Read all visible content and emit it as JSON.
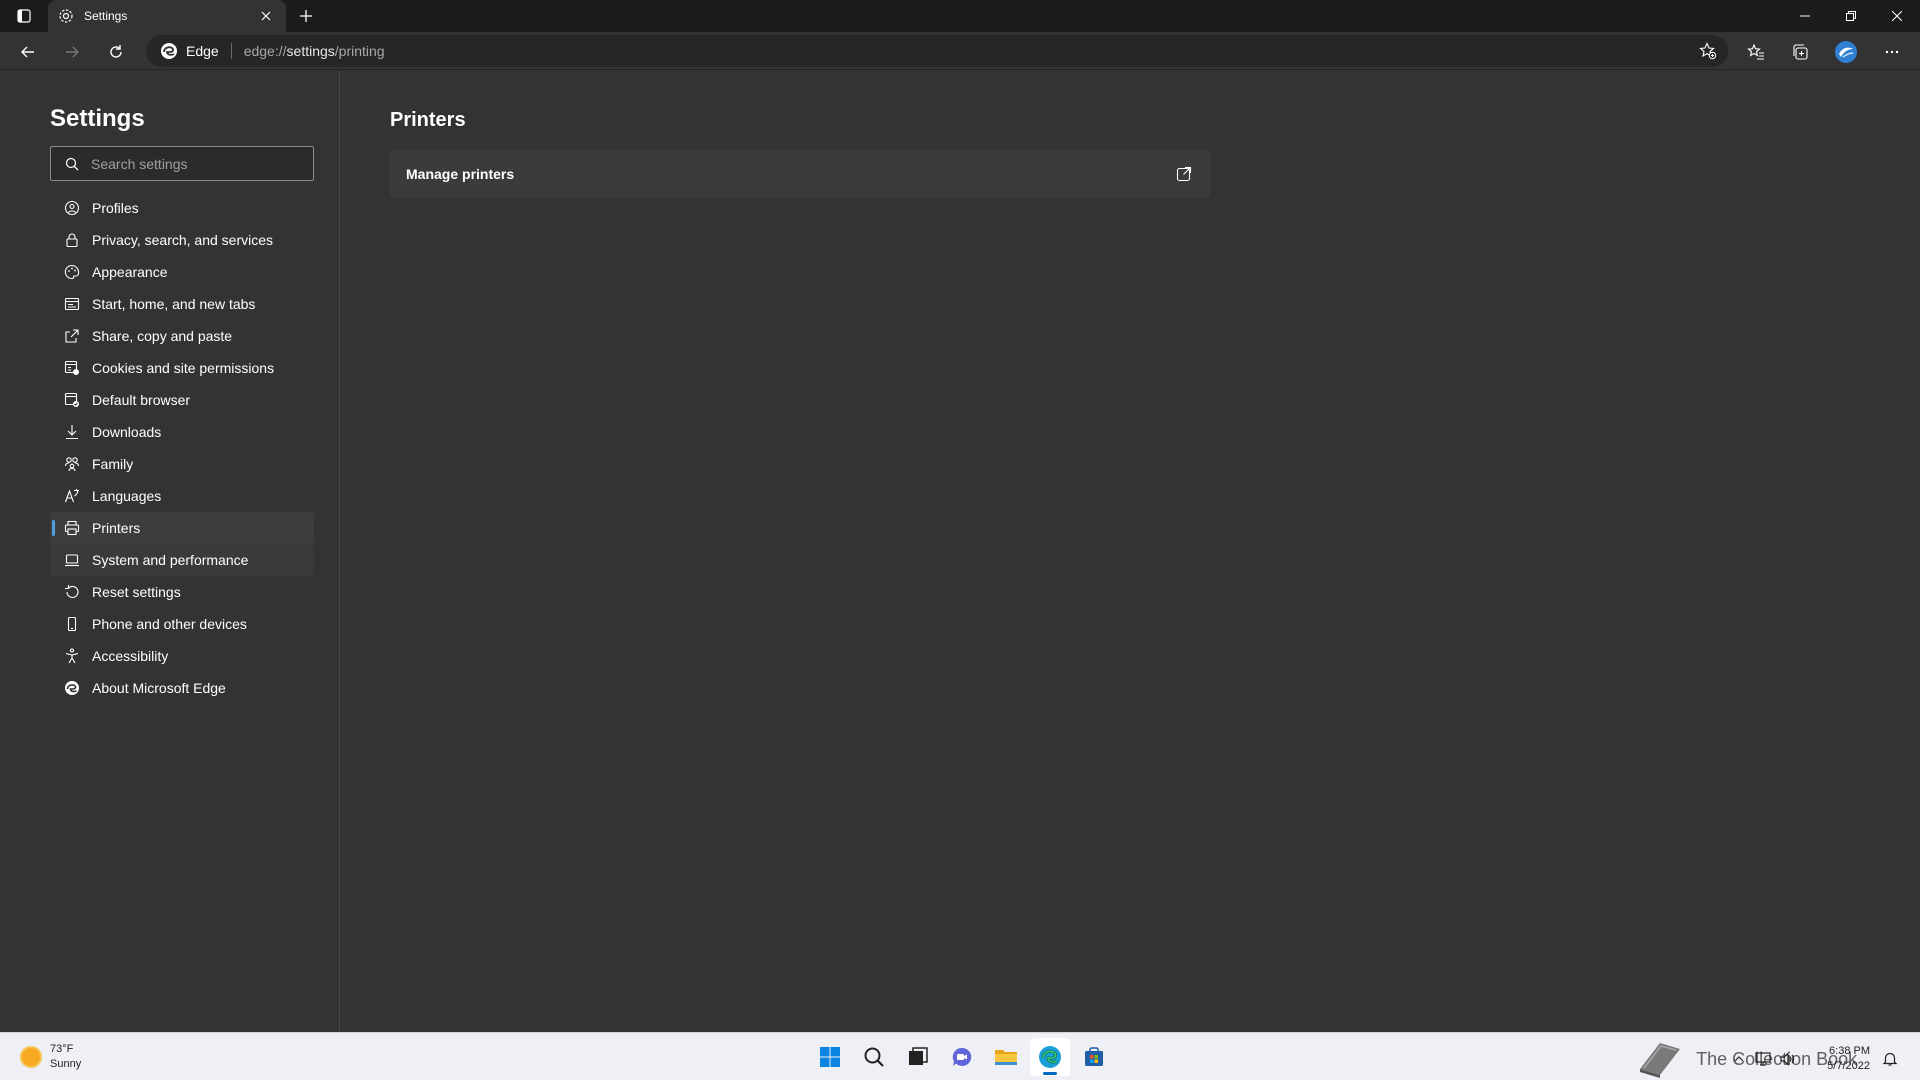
{
  "browser": {
    "tab": {
      "title": "Settings",
      "icon": "gear-icon"
    },
    "address": {
      "identity_label": "Edge",
      "url_prefix": "edge://",
      "url_host": "settings",
      "url_path": "/printing"
    }
  },
  "sidebar": {
    "title": "Settings",
    "search_placeholder": "Search settings",
    "items": [
      {
        "label": "Profiles",
        "icon": "profile-icon"
      },
      {
        "label": "Privacy, search, and services",
        "icon": "lock-icon"
      },
      {
        "label": "Appearance",
        "icon": "palette-icon"
      },
      {
        "label": "Start, home, and new tabs",
        "icon": "home-tab-icon"
      },
      {
        "label": "Share, copy and paste",
        "icon": "share-icon"
      },
      {
        "label": "Cookies and site permissions",
        "icon": "cookie-icon"
      },
      {
        "label": "Default browser",
        "icon": "browser-icon"
      },
      {
        "label": "Downloads",
        "icon": "download-icon"
      },
      {
        "label": "Family",
        "icon": "family-icon"
      },
      {
        "label": "Languages",
        "icon": "language-icon"
      },
      {
        "label": "Printers",
        "icon": "printer-icon"
      },
      {
        "label": "System and performance",
        "icon": "laptop-icon"
      },
      {
        "label": "Reset settings",
        "icon": "reset-icon"
      },
      {
        "label": "Phone and other devices",
        "icon": "phone-icon"
      },
      {
        "label": "Accessibility",
        "icon": "accessibility-icon"
      },
      {
        "label": "About Microsoft Edge",
        "icon": "edge-icon"
      }
    ],
    "active_item": "Printers"
  },
  "main": {
    "title": "Printers",
    "manage_printers_label": "Manage printers"
  },
  "taskbar": {
    "weather_temp": "73°F",
    "weather_desc": "Sunny",
    "watermark": "The Collection Book",
    "time": "6:38 PM",
    "date": "5/7/2022"
  },
  "colors": {
    "accent": "#4ca0e0",
    "page_bg": "#333333",
    "card_bg": "#3b3b3b"
  }
}
